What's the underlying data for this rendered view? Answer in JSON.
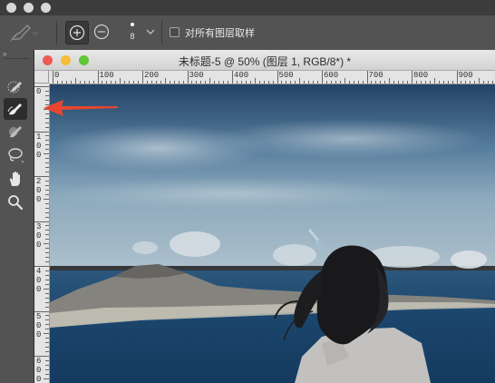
{
  "options_bar": {
    "brush_size": "8",
    "sample_all_layers_label": "对所有图层取样"
  },
  "document": {
    "title": "未标题-5 @ 50% (图层 1, RGB/8*) *",
    "ruler_h_labels": [
      "0",
      "100",
      "200",
      "300",
      "400",
      "500",
      "600",
      "700",
      "800",
      "900"
    ],
    "ruler_v_labels": [
      [
        "0"
      ],
      [
        "1",
        "0",
        "0"
      ],
      [
        "2",
        "0",
        "0"
      ],
      [
        "3",
        "0",
        "0"
      ],
      [
        "4",
        "0",
        "0"
      ],
      [
        "5",
        "0",
        "0"
      ],
      [
        "6",
        "0",
        "0"
      ]
    ]
  },
  "colors": {
    "close": "#ee5a52",
    "minimize": "#f6bd3b",
    "zoom": "#5fc738",
    "arrow": "#e8462f"
  },
  "toolbox": {
    "header": "»",
    "tools": [
      {
        "name": "quick-selection-icon",
        "selected": false
      },
      {
        "name": "refine-edge-brush-icon",
        "selected": true
      },
      {
        "name": "brush-icon",
        "selected": false
      },
      {
        "name": "lasso-icon",
        "selected": false
      },
      {
        "name": "hand-icon",
        "selected": false
      },
      {
        "name": "zoom-icon",
        "selected": false
      }
    ]
  }
}
